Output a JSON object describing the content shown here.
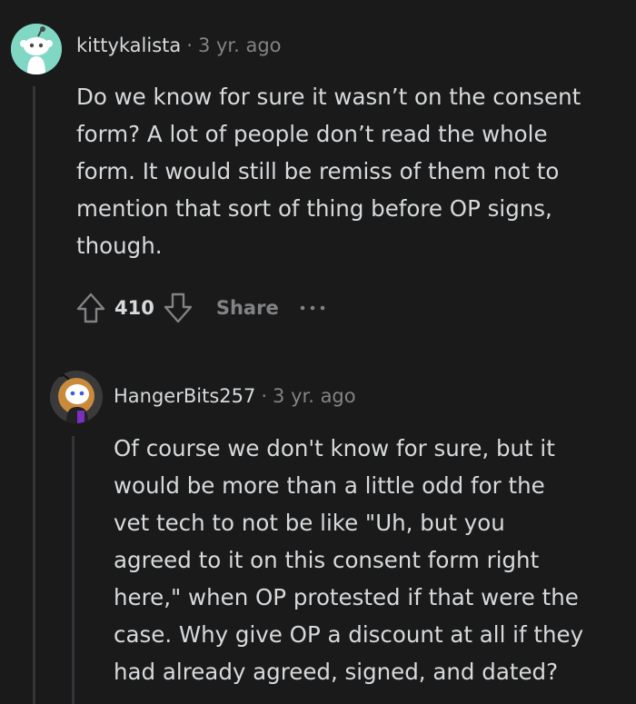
{
  "comment": {
    "author": "kittykalista",
    "separator": "·",
    "age": "3 yr. ago",
    "body_lines": [
      "Do we know for sure it wasn’t on the consent",
      "form? A lot of people don’t read the whole",
      "form. It would still be remiss of them not to",
      "mention that sort of thing before OP signs,",
      "though."
    ],
    "score": "410",
    "share_label": "Share",
    "avatar_color": "#7fd7c4"
  },
  "reply": {
    "author": "HangerBits257",
    "separator": "·",
    "age": "3 yr. ago",
    "body_lines": [
      "Of course we don't know for sure, but it",
      "would be more than a little odd for the",
      "vet tech to not be like \"Uh, but you",
      "agreed to it on this consent form right",
      "here,\" when OP protested if that were the",
      "case. Why give OP a discount at all if they",
      "had already agreed, signed, and dated?"
    ]
  },
  "icons": {
    "upvote": "upvote-arrow-icon",
    "downvote": "downvote-arrow-icon",
    "more": "more-options-icon"
  },
  "colors": {
    "background": "#1a1a1b",
    "text": "#d7dadc",
    "muted": "#818384",
    "thread_line": "#343536"
  }
}
